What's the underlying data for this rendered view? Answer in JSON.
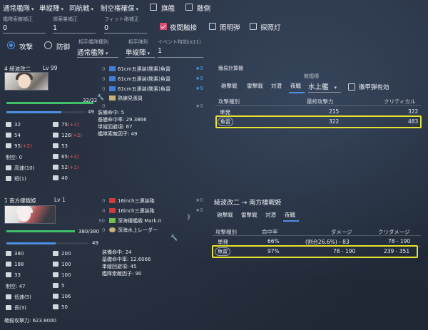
{
  "top": {
    "formation": "通常艦隊",
    "line": "単縦陣",
    "engagement": "同航戦",
    "air": "制空権確保",
    "flagship_label": "旗艦",
    "enemy_label": "敵側",
    "fleet_fix_label": "艦隊索敵補正",
    "fleet_fix_value": "0",
    "ammo_fix_label": "弾薬量補正",
    "ammo_fix_value": "1",
    "fit_fix_label": "フィット砲補正",
    "fit_fix_value": "0",
    "night_contact_label": "夜間触接",
    "star_shell_label": "照明弾",
    "searchlight_label": "探照灯"
  },
  "side": {
    "attack_label": "攻撃",
    "defense_label": "防御",
    "enemy_type_label": "相手艦隊種別",
    "enemy_type_value": "通常艦隊",
    "enemy_form_label": "相手陣形",
    "enemy_form_value": "単縦陣",
    "event_label": "イベント特効(a11)",
    "event_value": "1"
  },
  "ship1": {
    "name": "4 綾波改二",
    "level": "Lv 99",
    "hp": "32/32",
    "morale": "49",
    "equips": [
      {
        "n": "0",
        "name": "61cm五連装(酸素)魚雷",
        "star": "★9"
      },
      {
        "n": "0",
        "name": "61cm五連装(酸素)魚雷",
        "star": "★9"
      },
      {
        "n": "0",
        "name": "61cm五連装(酸素)魚雷",
        "star": "★9"
      },
      {
        "n": "",
        "name": "熟練見張員",
        "star": ""
      },
      {
        "n": "0",
        "name": "",
        "star": "★0"
      }
    ],
    "stats_left": [
      "32",
      "54",
      "95(+2)",
      "制空: 0",
      "高速(10)",
      "短(1)"
    ],
    "stats_right": [
      "75(+1)",
      "126(+2)",
      "53",
      "65(+2)",
      "52(+1)",
      "40"
    ],
    "info": [
      "装備命中: 5",
      "基礎命中率: 29.3866",
      "単縦回避項: 67",
      "艦隊索敵因子: 49"
    ]
  },
  "calc": {
    "title": "簡易計算機",
    "tabs": [
      "砲撃戦",
      "雷撃戦",
      "対潜",
      "夜戦"
    ],
    "target_label": "敵艦種",
    "target_value": "水上艦",
    "armor_label": "徹甲弾有効",
    "headers": [
      "攻撃種別",
      "最終攻撃力",
      "クリティカル"
    ],
    "rows": [
      {
        "type": "単発",
        "power": "215",
        "crit": "322"
      },
      {
        "type": "魚雷",
        "power": "322",
        "crit": "483"
      }
    ]
  },
  "ship2": {
    "name": "1 南方棲戦姫",
    "level": "Lv 1",
    "hp": "380/380",
    "morale": "49",
    "equips": [
      {
        "n": "0",
        "name": "16inch三連装砲",
        "star": "★0"
      },
      {
        "n": "0",
        "name": "16inch三連装砲",
        "star": "★0"
      },
      {
        "n": "90",
        "name": "深海褄艦戦 Mark.II",
        "star": ""
      },
      {
        "n": "0",
        "name": "深海水上レーダー",
        "star": ""
      }
    ],
    "stats_left": [
      "380",
      "188",
      "33",
      "制空: 47",
      "低速(5)",
      "長(3)"
    ],
    "stats_right": [
      "200",
      "100",
      "100",
      "5",
      "106",
      "50"
    ],
    "info": [
      "装備命中: 24",
      "基礎命中率: 12.6066",
      "単縦回避項: 45",
      "艦隊索敵因子: 90"
    ],
    "defense": "確殺攻撃力: 623.8000"
  },
  "battle": {
    "title": "綾波改二 → 南方棲戦姫",
    "tabs": [
      "砲撃戦",
      "雷撃戦",
      "対潜",
      "夜戦"
    ],
    "headers": [
      "攻撃種別",
      "命中率",
      "ダメージ",
      "クリダメージ"
    ],
    "rows": [
      {
        "type": "単発",
        "hit": "66%",
        "dmg": "(割合26.6%) - 83",
        "crit": "78 - 190"
      },
      {
        "type": "魚雷",
        "hit": "97%",
        "dmg": "78 - 190",
        "crit": "239 - 351"
      }
    ]
  }
}
